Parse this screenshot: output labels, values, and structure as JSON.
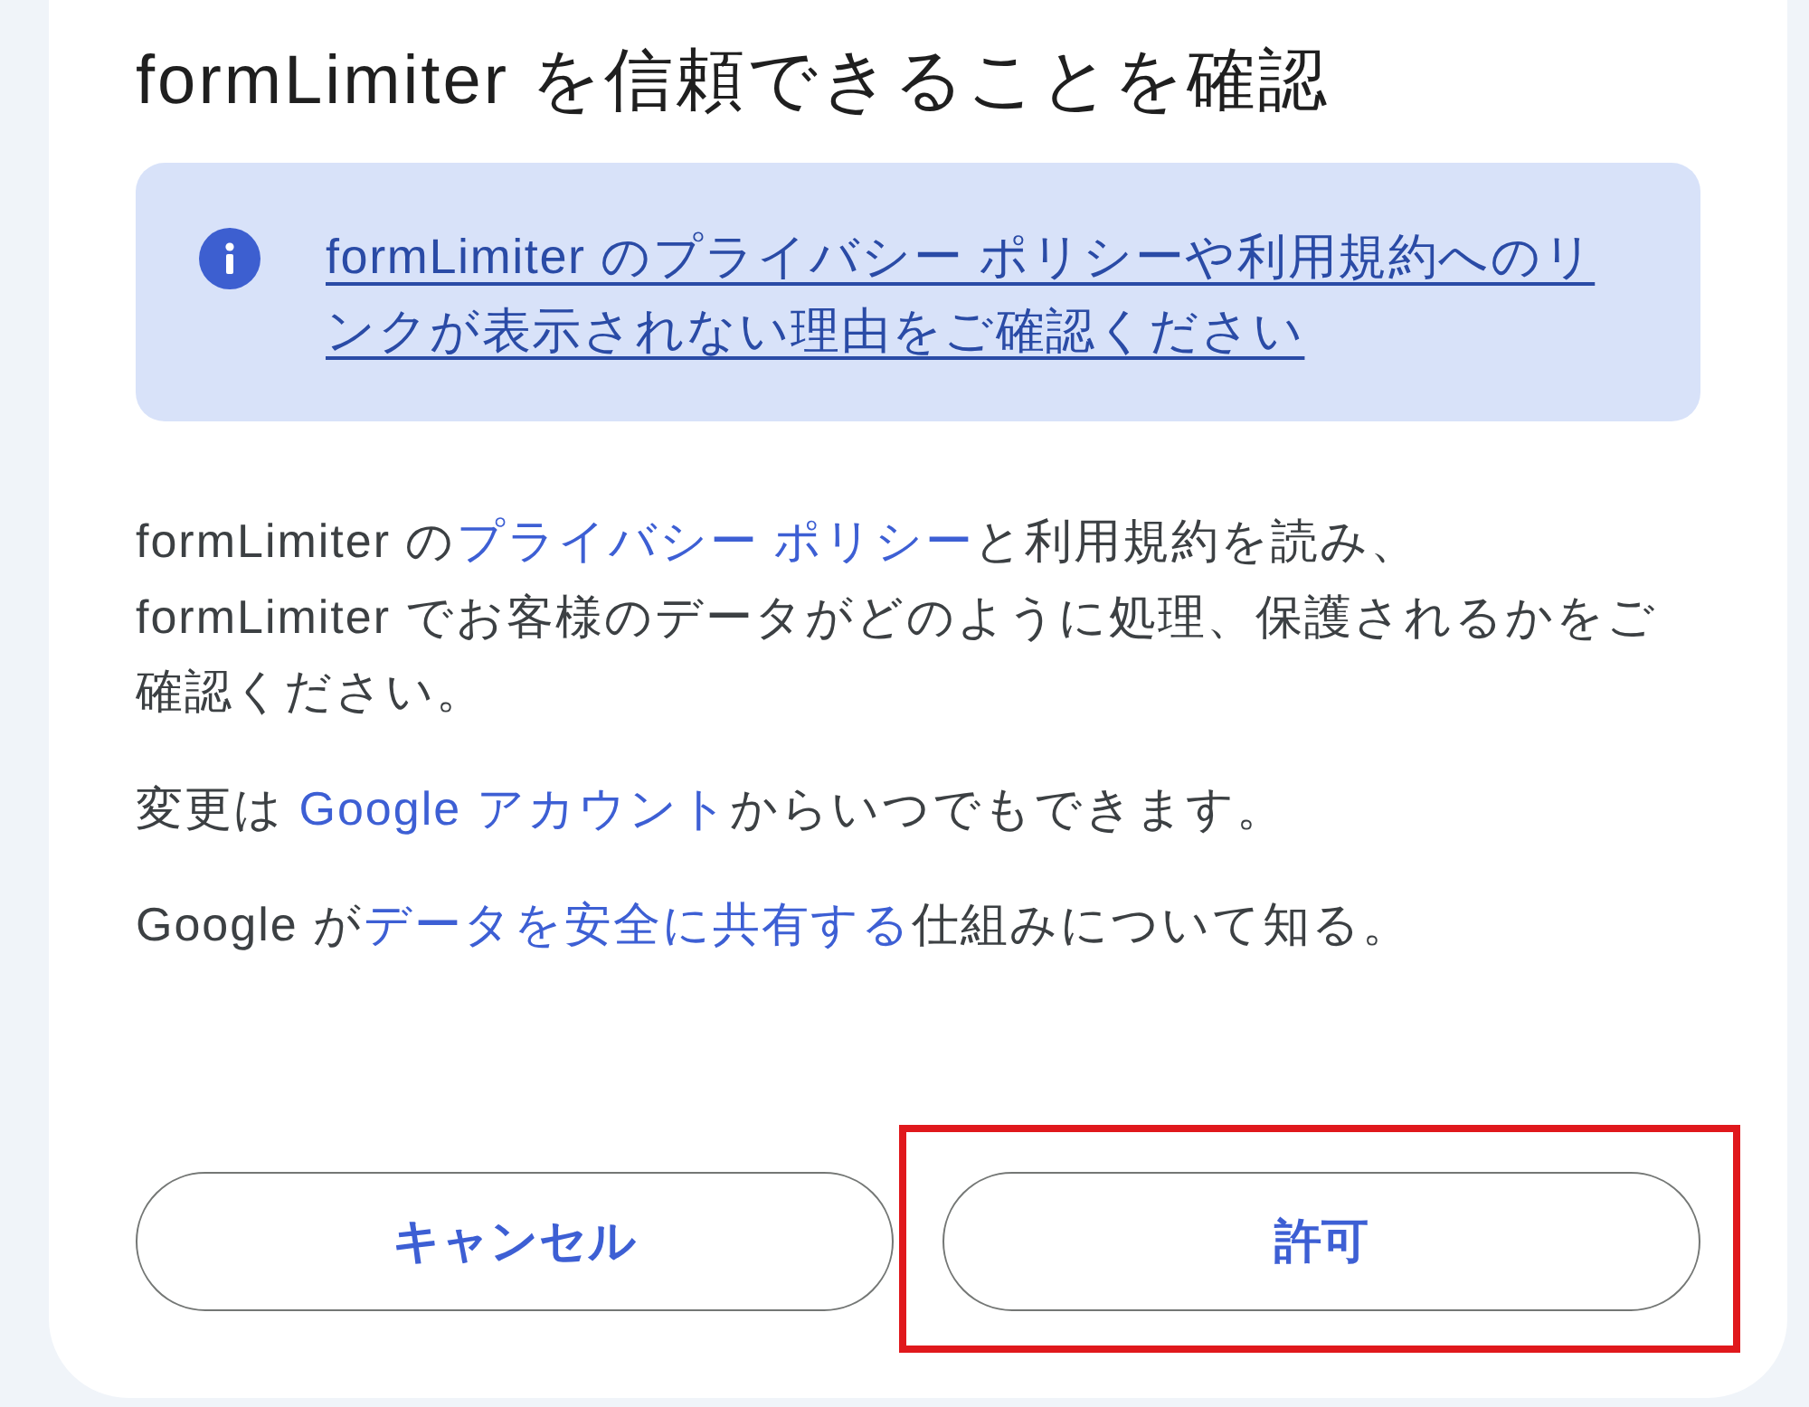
{
  "title": {
    "text": "formLimiter を信頼できることを確認"
  },
  "notice": {
    "link": "formLimiter のプライバシー ポリシーや利用規約へのリンクが表示されない理由をご確認ください"
  },
  "paragraphs": [
    {
      "segments": [
        {
          "kind": "text",
          "text": "formLimiter の"
        },
        {
          "kind": "link",
          "text": "プライバシー ポリシー"
        },
        {
          "kind": "text",
          "text": "と利用規約を読み、\nformLimiter でお客様のデータがどのように処理、保護されるかをご確認ください。"
        }
      ]
    },
    {
      "segments": [
        {
          "kind": "text",
          "text": "変更は "
        },
        {
          "kind": "link",
          "text": "Google アカウント"
        },
        {
          "kind": "text",
          "text": "からいつでもできます。"
        }
      ]
    },
    {
      "segments": [
        {
          "kind": "text",
          "text": "Google が"
        },
        {
          "kind": "link",
          "text": "データを安全に共有する"
        },
        {
          "kind": "text",
          "text": "仕組みについて知る。"
        }
      ]
    }
  ],
  "buttons": [
    {
      "label": "キャンセル",
      "highlighted": false
    },
    {
      "label": "許可",
      "highlighted": true
    }
  ]
}
